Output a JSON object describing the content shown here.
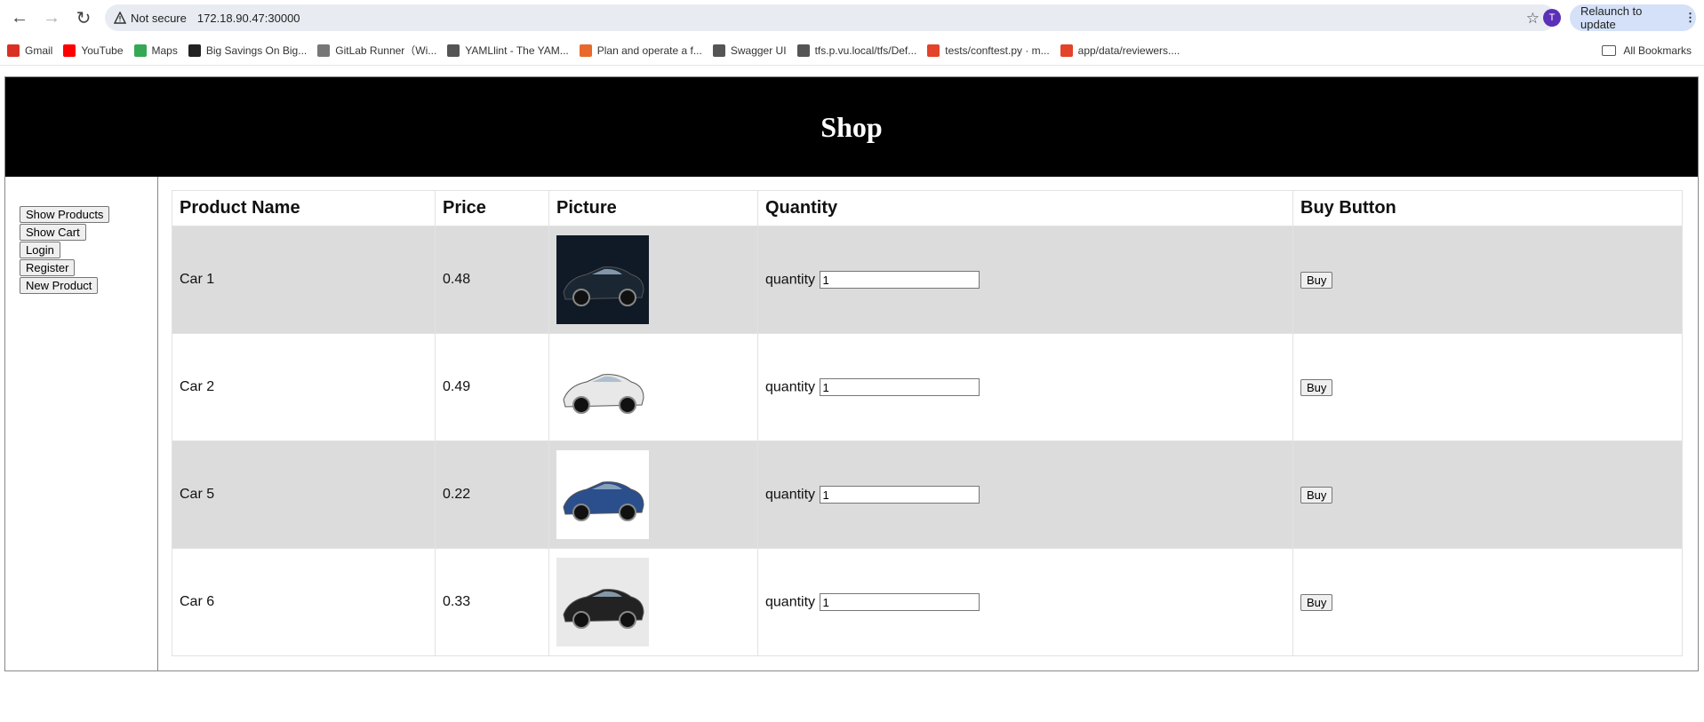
{
  "browser": {
    "security_label": "Not secure",
    "url": "172.18.90.47:30000",
    "avatar_letter": "T",
    "relaunch_label": "Relaunch to update",
    "bookmarks": [
      {
        "label": "Gmail",
        "icon": "gmail-icon",
        "color": "#d93025"
      },
      {
        "label": "YouTube",
        "icon": "youtube-icon",
        "color": "#ff0000"
      },
      {
        "label": "Maps",
        "icon": "maps-icon",
        "color": "#34a853"
      },
      {
        "label": "Big Savings On Big...",
        "icon": "store-icon",
        "color": "#222222"
      },
      {
        "label": "GitLab Runner（Wi...",
        "icon": "runner-icon",
        "color": "#777777"
      },
      {
        "label": "YAMLlint - The YAM...",
        "icon": "globe-icon",
        "color": "#555555"
      },
      {
        "label": "Plan and operate a f...",
        "icon": "gitlab-icon",
        "color": "#e8692b"
      },
      {
        "label": "Swagger UI",
        "icon": "globe-icon",
        "color": "#555555"
      },
      {
        "label": "tfs.p.vu.local/tfs/Def...",
        "icon": "globe-icon",
        "color": "#555555"
      },
      {
        "label": "tests/conftest.py · m...",
        "icon": "gitlab-icon",
        "color": "#e24329"
      },
      {
        "label": "app/data/reviewers....",
        "icon": "gitlab-icon",
        "color": "#e24329"
      }
    ],
    "all_bookmarks_label": "All Bookmarks"
  },
  "shop": {
    "title": "Shop",
    "sidebar_buttons": [
      "Show Products",
      "Show Cart",
      "Login",
      "Register",
      "New Product"
    ],
    "columns": [
      "Product Name",
      "Price",
      "Picture",
      "Quantity",
      "Buy Button"
    ],
    "quantity_label": "quantity",
    "buy_label": "Buy",
    "products": [
      {
        "name": "Car 1",
        "price": "0.48",
        "quantity": "1",
        "car_color": "#1a2733",
        "bg": "#0f1a26"
      },
      {
        "name": "Car 2",
        "price": "0.49",
        "quantity": "1",
        "car_color": "#e8e8e8",
        "bg": "#ffffff"
      },
      {
        "name": "Car 5",
        "price": "0.22",
        "quantity": "1",
        "car_color": "#2a4f8c",
        "bg": "#ffffff"
      },
      {
        "name": "Car 6",
        "price": "0.33",
        "quantity": "1",
        "car_color": "#222222",
        "bg": "#e9e9e9"
      }
    ]
  }
}
